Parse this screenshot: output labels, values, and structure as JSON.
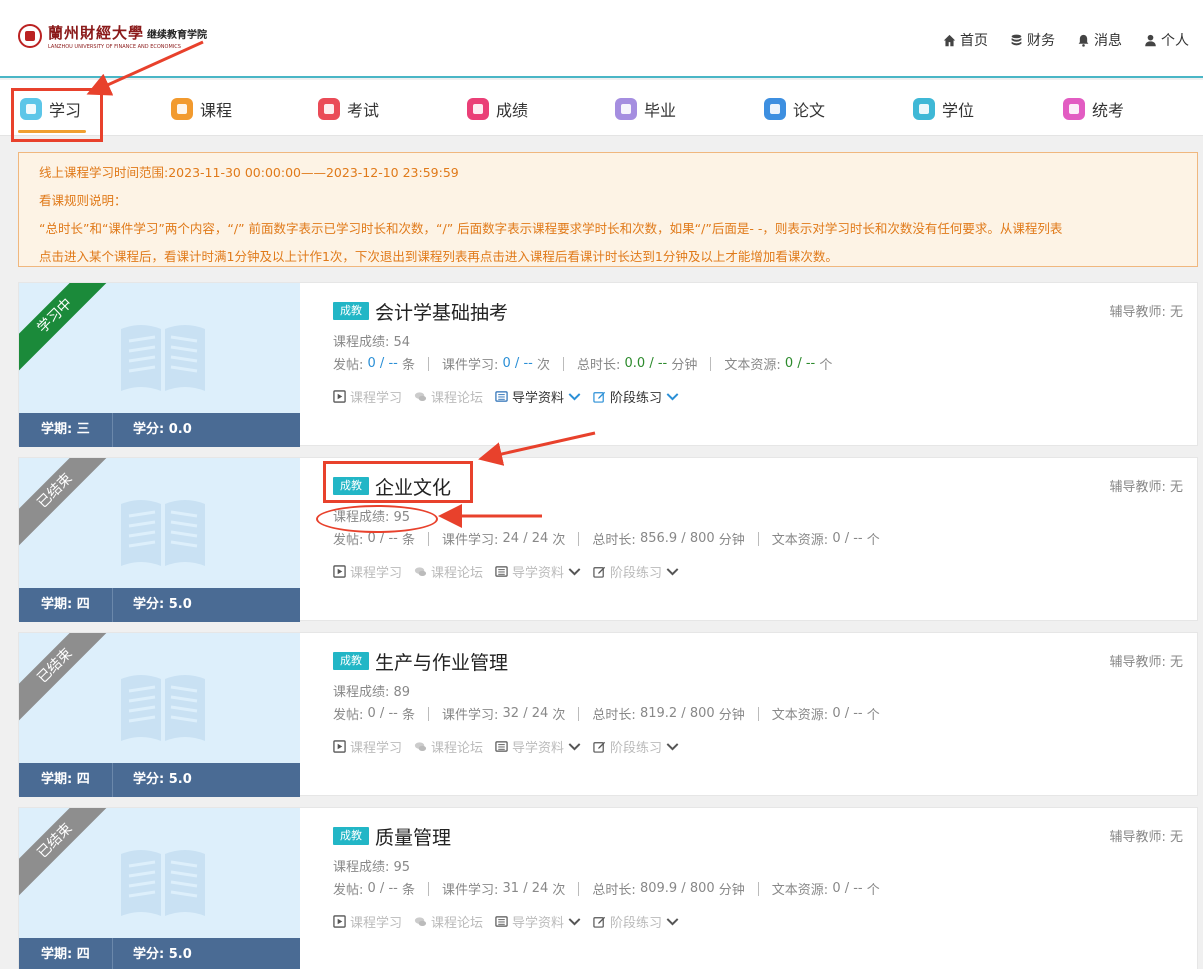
{
  "header": {
    "logo_main": "蘭州財經大學",
    "logo_suffix": "继续教育学院",
    "logo_sub": "LANZHOU UNIVERSITY OF FINANCE AND ECONOMICS",
    "nav": [
      {
        "label": "首页",
        "icon": "home-icon"
      },
      {
        "label": "财务",
        "icon": "database-icon"
      },
      {
        "label": "消息",
        "icon": "bell-icon"
      },
      {
        "label": "个人",
        "icon": "user-icon"
      }
    ]
  },
  "tabs": [
    {
      "label": "学习",
      "color": "#5cc6e8",
      "active": true
    },
    {
      "label": "课程",
      "color": "#f29a2e"
    },
    {
      "label": "考试",
      "color": "#ea4b57"
    },
    {
      "label": "成绩",
      "color": "#ea3f77"
    },
    {
      "label": "毕业",
      "color": "#a58ee0"
    },
    {
      "label": "论文",
      "color": "#3d8fe0"
    },
    {
      "label": "学位",
      "color": "#3fb8d6"
    },
    {
      "label": "统考",
      "color": "#e25cc2"
    }
  ],
  "notice": {
    "line1": "线上课程学习时间范围:2023-11-30 00:00:00——2023-12-10 23:59:59",
    "line2": "看课规则说明：",
    "line3": "“总时长”和“课件学习”两个内容，“/” 前面数字表示已学习时长和次数，“/” 后面数字表示课程要求学时长和次数，如果“/”后面是- -，则表示对学习时长和次数没有任何要求。从课程列表",
    "line4": "点击进入某个课程后，看课计时满1分钟及以上计作1次，下次退出到课程列表再点击进入课程后看课计时长达到1分钟及以上才能增加看课次数。"
  },
  "labels": {
    "badge": "成教",
    "tutor": "辅导教师: 无",
    "score_prefix": "课程成绩: ",
    "posts": "发帖: ",
    "posts_unit": "条",
    "courseware": "课件学习: ",
    "courseware_unit": "次",
    "duration": "总时长: ",
    "duration_unit": "分钟",
    "resources": "文本资源: ",
    "resources_unit": "个",
    "term_prefix": "学期: ",
    "credit_prefix": "学分: ",
    "act_study": "课程学习",
    "act_forum": "课程论坛",
    "act_guide": "导学资料",
    "act_practice": "阶段练习"
  },
  "courses": [
    {
      "title": "会计学基础抽考",
      "status": "学习中",
      "score": "54",
      "posts": "0 / --",
      "courseware": "0 / --",
      "duration": "0.0 / --",
      "resources": "0 / --",
      "term": "三",
      "credit": "0.0",
      "active": true
    },
    {
      "title": "企业文化",
      "status": "已结束",
      "score": "95",
      "posts": "0 / --",
      "courseware": "24 / 24",
      "duration": "856.9 / 800",
      "resources": "0 / --",
      "term": "四",
      "credit": "5.0",
      "active": false
    },
    {
      "title": "生产与作业管理",
      "status": "已结束",
      "score": "89",
      "posts": "0 / --",
      "courseware": "32 / 24",
      "duration": "819.2 / 800",
      "resources": "0 / --",
      "term": "四",
      "credit": "5.0",
      "active": false
    },
    {
      "title": "质量管理",
      "status": "已结束",
      "score": "95",
      "posts": "0 / --",
      "courseware": "31 / 24",
      "duration": "809.9 / 800",
      "resources": "0 / --",
      "term": "四",
      "credit": "5.0",
      "active": false
    }
  ],
  "colors": {
    "accent": "#4ab6c6",
    "annotation": "#e8412c",
    "notice_text": "#e07a1a",
    "badge": "#22b6c6"
  }
}
